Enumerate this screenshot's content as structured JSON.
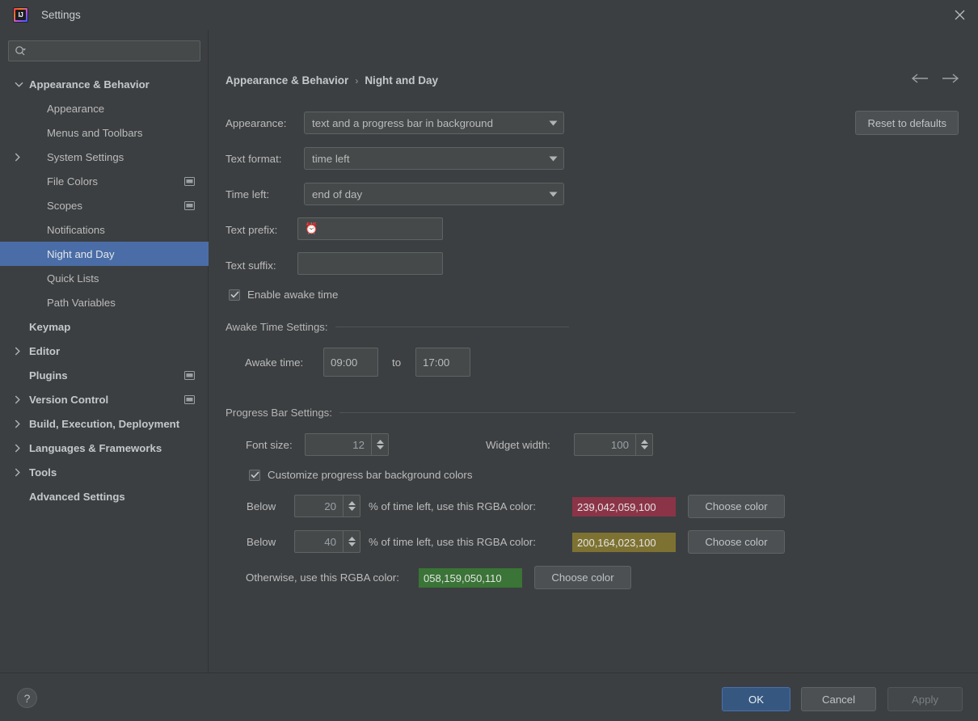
{
  "window": {
    "title": "Settings",
    "logo_icon": "intellij-idea-logo",
    "close_icon": "close-icon"
  },
  "sidebar": {
    "search": {
      "placeholder": "",
      "value": "",
      "icon": "search-icon"
    },
    "items": [
      {
        "label": "Appearance & Behavior",
        "level": 0,
        "chevron": "chevron-down-icon",
        "badge": false,
        "selected": false
      },
      {
        "label": "Appearance",
        "level": 1,
        "chevron": "",
        "badge": false,
        "selected": false
      },
      {
        "label": "Menus and Toolbars",
        "level": 1,
        "chevron": "",
        "badge": false,
        "selected": false
      },
      {
        "label": "System Settings",
        "level": 1,
        "chevron": "chevron-right-icon",
        "badge": false,
        "selected": false
      },
      {
        "label": "File Colors",
        "level": 1,
        "chevron": "",
        "badge": true,
        "selected": false
      },
      {
        "label": "Scopes",
        "level": 1,
        "chevron": "",
        "badge": true,
        "selected": false
      },
      {
        "label": "Notifications",
        "level": 1,
        "chevron": "",
        "badge": false,
        "selected": false
      },
      {
        "label": "Night and Day",
        "level": 1,
        "chevron": "",
        "badge": false,
        "selected": true
      },
      {
        "label": "Quick Lists",
        "level": 1,
        "chevron": "",
        "badge": false,
        "selected": false
      },
      {
        "label": "Path Variables",
        "level": 1,
        "chevron": "",
        "badge": false,
        "selected": false
      },
      {
        "label": "Keymap",
        "level": 0,
        "chevron": "",
        "badge": false,
        "selected": false
      },
      {
        "label": "Editor",
        "level": 0,
        "chevron": "chevron-right-icon",
        "badge": false,
        "selected": false
      },
      {
        "label": "Plugins",
        "level": 0,
        "chevron": "",
        "badge": true,
        "selected": false
      },
      {
        "label": "Version Control",
        "level": 0,
        "chevron": "chevron-right-icon",
        "badge": true,
        "selected": false
      },
      {
        "label": "Build, Execution, Deployment",
        "level": 0,
        "chevron": "chevron-right-icon",
        "badge": false,
        "selected": false
      },
      {
        "label": "Languages & Frameworks",
        "level": 0,
        "chevron": "chevron-right-icon",
        "badge": false,
        "selected": false
      },
      {
        "label": "Tools",
        "level": 0,
        "chevron": "chevron-right-icon",
        "badge": false,
        "selected": false
      },
      {
        "label": "Advanced Settings",
        "level": 0,
        "chevron": "",
        "badge": false,
        "selected": false
      }
    ]
  },
  "main": {
    "breadcrumb": {
      "root": "Appearance & Behavior",
      "separator": "›",
      "current": "Night and Day"
    },
    "nav": {
      "back_icon": "arrow-left-icon",
      "forward_icon": "arrow-right-icon"
    },
    "reset_label": "Reset to defaults",
    "appearance": {
      "label": "Appearance:",
      "value": "text and a progress bar in background"
    },
    "text_format": {
      "label": "Text format:",
      "value": "time left"
    },
    "time_left": {
      "label": "Time left:",
      "value": "end of day"
    },
    "text_prefix": {
      "label": "Text prefix:",
      "value": "⏰"
    },
    "text_suffix": {
      "label": "Text suffix:",
      "value": ""
    },
    "enable_awake": {
      "label": "Enable awake time",
      "checked": true
    },
    "awake_section": {
      "title": "Awake Time Settings:"
    },
    "awake_time": {
      "label": "Awake time:",
      "from": "09:00",
      "to_label": "to",
      "to": "17:00"
    },
    "progress_section": {
      "title": "Progress Bar Settings:"
    },
    "font_size": {
      "label": "Font size:",
      "value": "12"
    },
    "widget_width": {
      "label": "Widget width:",
      "value": "100"
    },
    "customize_colors": {
      "label": "Customize progress bar background colors",
      "checked": true
    },
    "color_rows": [
      {
        "prefix": "Below",
        "threshold": "20",
        "suffix": "% of time left, use this RGBA color:",
        "rgba_text": "239,042,059,100",
        "swatch_hex": "#8b3447",
        "button_label": "Choose color"
      },
      {
        "prefix": "Below",
        "threshold": "40",
        "suffix": "% of time left, use this RGBA color:",
        "rgba_text": "200,164,023,100",
        "swatch_hex": "#7e7232",
        "button_label": "Choose color"
      }
    ],
    "otherwise_row": {
      "label": "Otherwise, use this RGBA color:",
      "rgba_text": "058,159,050,110",
      "swatch_hex": "#3a7436",
      "button_label": "Choose color"
    }
  },
  "footer": {
    "help_label": "?",
    "ok_label": "OK",
    "cancel_label": "Cancel",
    "apply_label": "Apply"
  },
  "colors": {
    "background": "#3c3f41",
    "selection": "#4a6da7",
    "primary_button": "#365880",
    "field_background": "#45494a",
    "border": "#5e6364",
    "text": "#bbbbbb"
  }
}
